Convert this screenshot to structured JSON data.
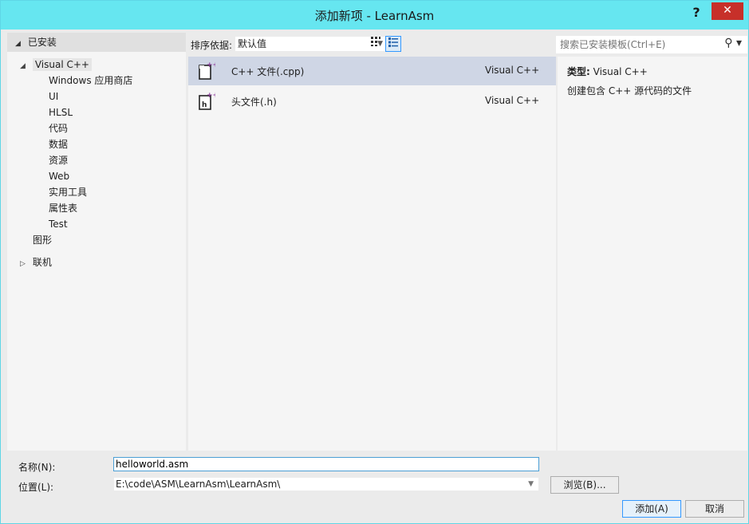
{
  "window": {
    "title": "添加新项 - LearnAsm",
    "help": "?",
    "close": "✕"
  },
  "left": {
    "installed": "已安装",
    "visual_cpp": "Visual C++",
    "children": [
      "Windows 应用商店",
      "UI",
      "HLSL",
      "代码",
      "数据",
      "资源",
      "Web",
      "实用工具",
      "属性表",
      "Test"
    ],
    "graphics": "图形",
    "online": "联机"
  },
  "toolbar": {
    "sort_label": "排序依据:",
    "sort_value": "默认值"
  },
  "items": [
    {
      "name": "C++ 文件(.cpp)",
      "lang": "Visual C++",
      "selected": true
    },
    {
      "name": "头文件(.h)",
      "lang": "Visual C++",
      "selected": false
    }
  ],
  "search": {
    "placeholder": "搜索已安装模板(Ctrl+E)"
  },
  "details": {
    "type_label": "类型:",
    "type_value": "Visual C++",
    "description": "创建包含 C++ 源代码的文件"
  },
  "form": {
    "name_label": "名称(N):",
    "name_value": "helloworld.asm",
    "location_label": "位置(L):",
    "location_value": "E:\\code\\ASM\\LearnAsm\\LearnAsm\\"
  },
  "buttons": {
    "browse": "浏览(B)...",
    "add": "添加(A)",
    "cancel": "取消"
  }
}
